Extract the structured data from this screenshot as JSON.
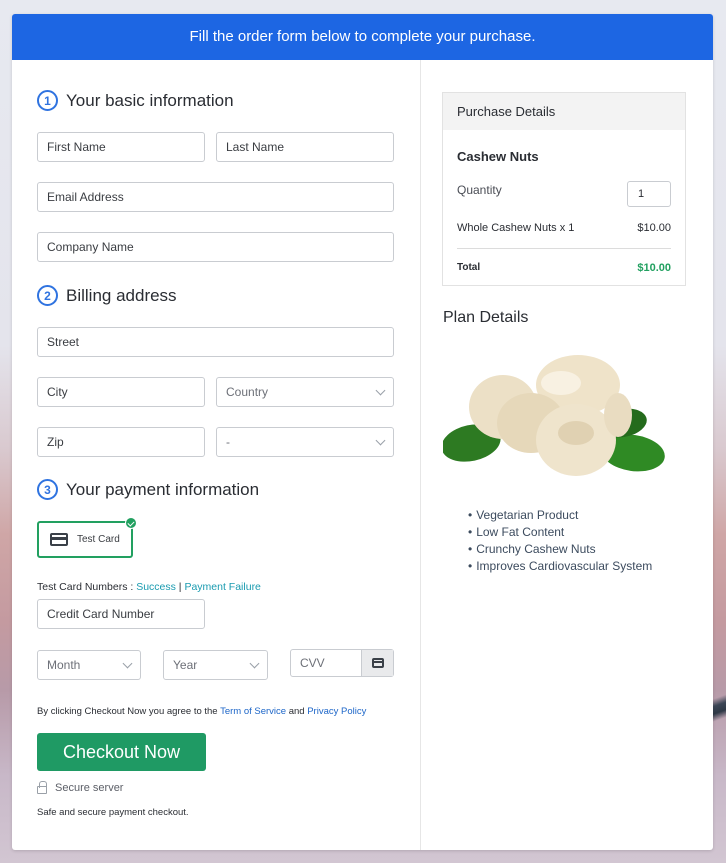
{
  "banner": {
    "text": "Fill the order form below to complete your purchase."
  },
  "sections": {
    "basic": {
      "number": "1",
      "title": "Your basic information"
    },
    "billing": {
      "number": "2",
      "title": "Billing address"
    },
    "payment": {
      "number": "3",
      "title": "Your payment information"
    }
  },
  "fields": {
    "first_name": "First Name",
    "last_name": "Last Name",
    "email": "Email Address",
    "company": "Company Name",
    "street": "Street",
    "city": "City",
    "country": "Country",
    "zip": "Zip",
    "state": "-",
    "card_number": "Credit Card Number",
    "month": "Month",
    "year": "Year",
    "cvv": "CVV"
  },
  "payment": {
    "method_label": "Test Card",
    "test_numbers_prefix": "Test Card Numbers : ",
    "success_link": "Success",
    "separator": " | ",
    "failure_link": "Payment Failure"
  },
  "terms": {
    "prefix": "By clicking Checkout Now you agree to the ",
    "tos": "Term of Service",
    "and": " and ",
    "privacy": "Privacy Policy"
  },
  "checkout_label": "Checkout Now",
  "secure_label": "Secure server",
  "safe_text": "Safe and secure payment checkout.",
  "purchase": {
    "title": "Purchase Details",
    "product": "Cashew Nuts",
    "quantity_label": "Quantity",
    "quantity_value": "1",
    "line_item": "Whole Cashew Nuts x 1",
    "line_price": "$10.00",
    "total_label": "Total",
    "total_value": "$10.00",
    "total_color": "#22a060"
  },
  "plan": {
    "title": "Plan Details",
    "features": [
      "Vegetarian Product",
      "Low Fat Content",
      "Crunchy Cashew Nuts",
      "Improves Cardiovascular System"
    ]
  },
  "colors": {
    "brand_blue": "#1d66e3",
    "checkout_green": "#1f9a64"
  }
}
